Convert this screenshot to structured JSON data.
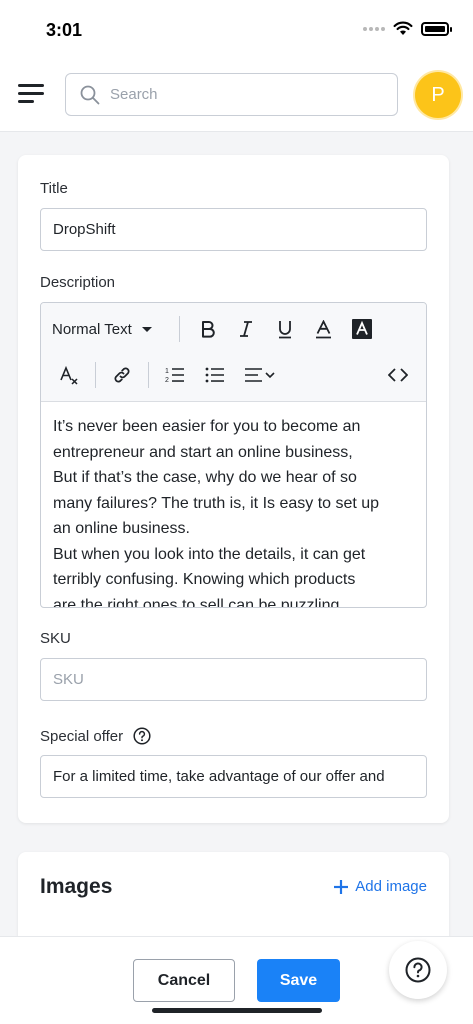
{
  "status_bar": {
    "time": "3:01"
  },
  "header": {
    "search_placeholder": "Search",
    "avatar_initial": "P",
    "avatar_color": "#fcc419"
  },
  "form": {
    "title_label": "Title",
    "title_value": "DropShift",
    "description_label": "Description",
    "toolbar": {
      "format_select": "Normal Text",
      "icons": [
        "bold-icon",
        "italic-icon",
        "underline-icon",
        "font-color-icon",
        "highlight-color-icon",
        "clear-format-icon",
        "link-icon",
        "ordered-list-icon",
        "bullet-list-icon",
        "align-icon",
        "code-view-icon"
      ]
    },
    "description_lines": [
      "It’s never been easier for you to become an",
      "entrepreneur and start an online business,",
      "But if that’s the case, why do we hear of so",
      "many failures? The truth is, it Is easy to set up",
      "an online business.",
      "But when you look into the details, it can get",
      "terribly confusing. Knowing which products",
      "are the right ones to sell can be puzzling."
    ],
    "sku_label": "SKU",
    "sku_placeholder": "SKU",
    "special_offer_label": "Special offer",
    "special_offer_value": "For a limited time, take advantage of our offer and"
  },
  "images": {
    "title": "Images",
    "add_image_label": "Add image"
  },
  "footer": {
    "cancel_label": "Cancel",
    "save_label": "Save"
  },
  "colors": {
    "primary": "#1a82f7",
    "link": "#1f74e8"
  }
}
